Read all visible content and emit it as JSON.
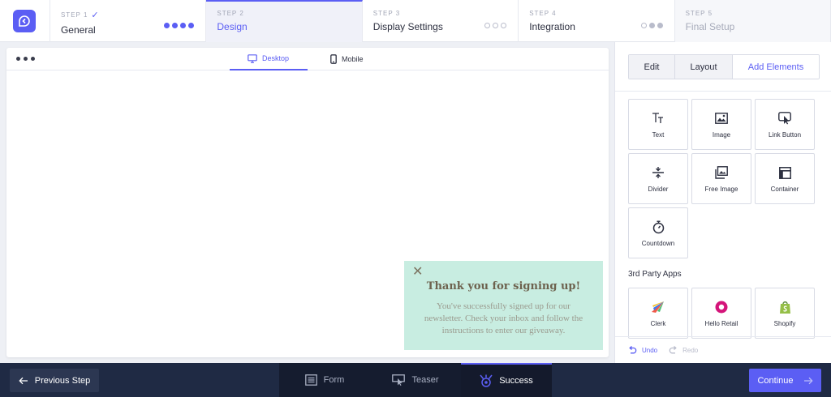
{
  "steps": [
    {
      "number": "STEP 1",
      "name": "General",
      "state": "done",
      "check": "✓"
    },
    {
      "number": "STEP 2",
      "name": "Design",
      "state": "active"
    },
    {
      "number": "STEP 3",
      "name": "Display Settings",
      "state": "pending"
    },
    {
      "number": "STEP 4",
      "name": "Integration",
      "state": "partial"
    },
    {
      "number": "STEP 5",
      "name": "Final Setup",
      "state": "disabled"
    }
  ],
  "canvas": {
    "device_tabs": {
      "desktop": "Desktop",
      "mobile": "Mobile"
    },
    "popup": {
      "close_glyph": "✕",
      "title": "Thank you for signing up!",
      "body": "You've successfully signed up for our newsletter. Check your inbox and follow the instructions to enter our giveaway."
    }
  },
  "panel": {
    "tabs": {
      "edit": "Edit",
      "layout": "Layout",
      "add": "Add Elements"
    },
    "elements": [
      {
        "label": "Text",
        "icon": "text-icon"
      },
      {
        "label": "Image",
        "icon": "image-icon"
      },
      {
        "label": "Link Button",
        "icon": "link-button-icon"
      },
      {
        "label": "Divider",
        "icon": "divider-icon"
      },
      {
        "label": "Free Image",
        "icon": "free-image-icon"
      },
      {
        "label": "Container",
        "icon": "container-icon"
      },
      {
        "label": "Countdown",
        "icon": "countdown-icon"
      }
    ],
    "apps_heading": "3rd Party Apps",
    "apps": [
      {
        "label": "Clerk",
        "icon": "clerk-icon"
      },
      {
        "label": "Hello Retail",
        "icon": "hello-retail-icon"
      },
      {
        "label": "Shopify",
        "icon": "shopify-icon"
      }
    ],
    "undo": "Undo",
    "redo": "Redo"
  },
  "bottom": {
    "previous": "Previous Step",
    "modes": {
      "form": "Form",
      "teaser": "Teaser",
      "success": "Success"
    },
    "continue": "Continue"
  },
  "colors": {
    "accent": "#5b5ef4",
    "popup_bg": "#c8ede1",
    "bottom_bar": "#1f2a44"
  }
}
